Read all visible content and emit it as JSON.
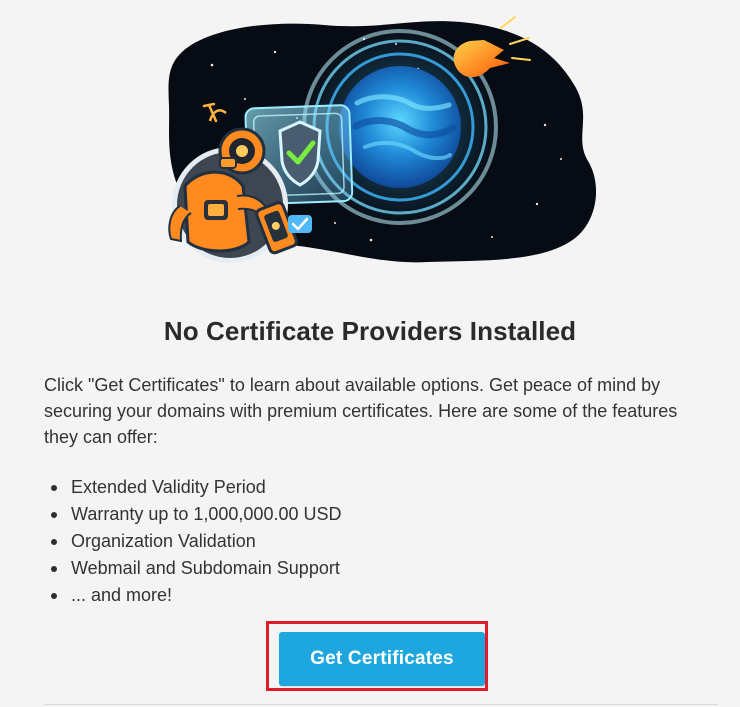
{
  "empty_state": {
    "title": "No Certificate Providers Installed",
    "description": "Click \"Get Certificates\" to learn about available options. Get peace of mind by securing your domains with premium certificates. Here are some of the features they can offer:",
    "features": [
      "Extended Validity Period",
      "Warranty up to 1,000,000.00 USD",
      "Organization Validation",
      "Webmail and Subdomain Support",
      "... and more!"
    ],
    "button_label": "Get Certificates"
  },
  "colors": {
    "page_background": "#f4f4f4",
    "button_background": "#1ea7de",
    "highlight_border": "#e11b2b",
    "text": "#333333"
  },
  "icons": {
    "hero": "space-robot-shield-illustration",
    "shield": "shield-check-icon"
  }
}
